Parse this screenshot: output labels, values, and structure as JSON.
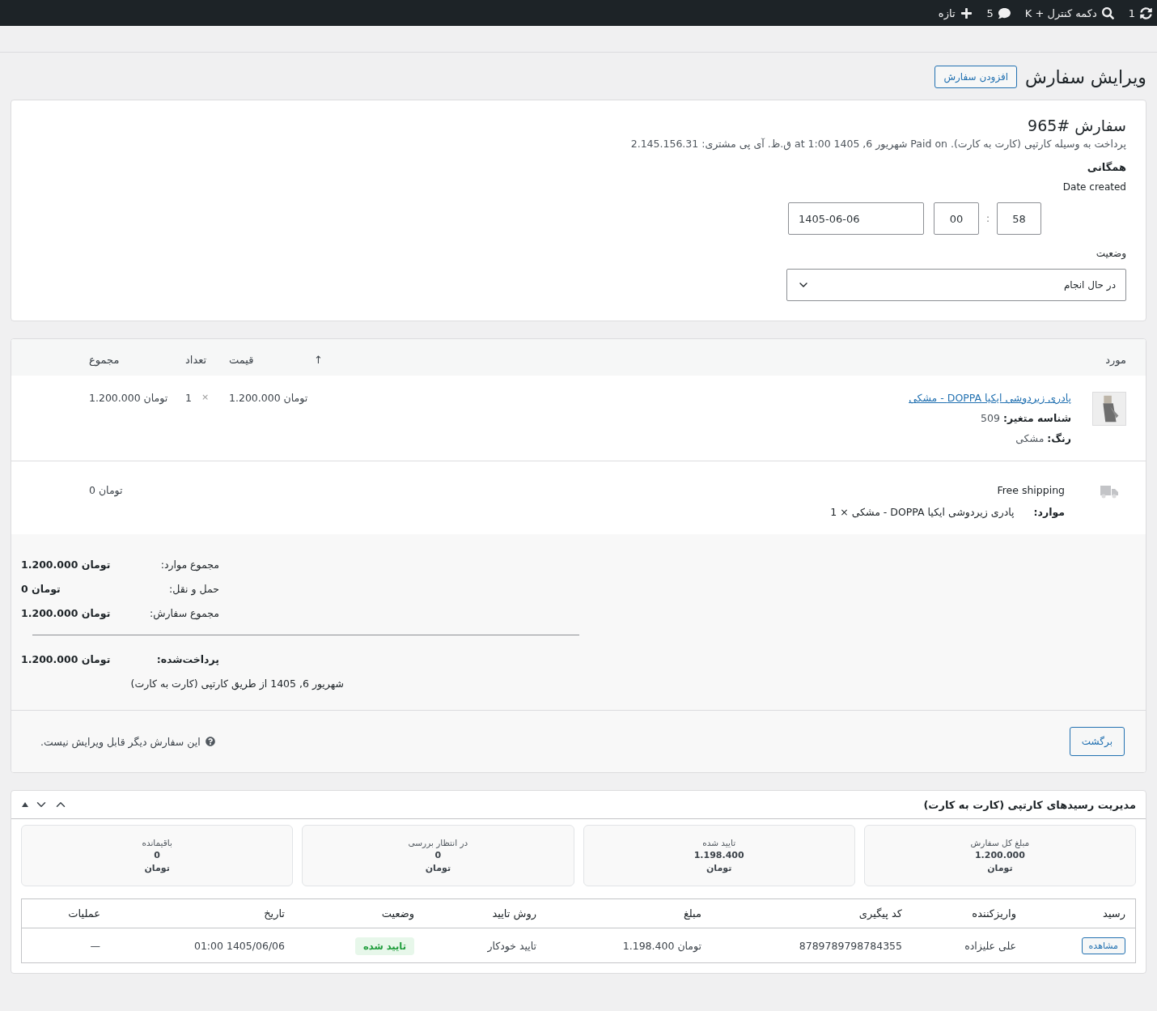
{
  "admin_bar": {
    "items": [
      {
        "kind": "updates",
        "label": "1"
      },
      {
        "kind": "search",
        "label": "دکمه کنترل + K"
      },
      {
        "kind": "comments",
        "label": "5"
      },
      {
        "kind": "new",
        "label": "تازه"
      }
    ]
  },
  "page": {
    "title": "ویرایش سفارش",
    "add_button": "افزودن سفارش"
  },
  "order": {
    "title": "سفارش #965",
    "meta": "پرداخت به وسیله کارتپی (کارت به کارت). Paid on شهریور 6, 1405 at 1:00 ق.ظ. آی پی مشتری: 2.145.156.31",
    "section": "همگانی",
    "date_label": "Date created",
    "date": "1405-06-06",
    "hour": "00",
    "separator": ":",
    "minute": "58",
    "status_label": "وضعیت",
    "status": "در حال انجام"
  },
  "items": {
    "columns": [
      "مورد",
      "↑",
      "قیمت",
      "تعداد",
      "مجموع"
    ],
    "rows": [
      {
        "name": "پادری زیردوشی ایکیا DOPPA - مشکی",
        "meta": [
          "**شناسه متغیر:** 509",
          "**رنگ:** مشکی"
        ],
        "price": "1.200.000 تومان",
        "qty_sign": "×",
        "qty": "1",
        "total": "1.200.000 تومان"
      }
    ],
    "shipping": {
      "method": "Free shipping",
      "items_label": "موارد:",
      "items": "پادری زیردوشی ایکیا DOPPA - مشکی × 1",
      "total": "0 تومان"
    },
    "totals": [
      {
        "label": "مجموع موارد:",
        "value": "1.200.000 تومان"
      },
      {
        "label": "حمل و نقل:",
        "value": "0 تومان"
      },
      {
        "label": "مجموع سفارش:",
        "value": "1.200.000 تومان"
      }
    ],
    "paid": {
      "label": "پرداخت‌شده:",
      "value": "1.200.000 تومان",
      "note": "شهریور 6, 1405 از طریق کارتپی (کارت به کارت)"
    },
    "back_button": "برگشت",
    "notice": "این سفارش دیگر قابل ویرایش نیست."
  },
  "receipts": {
    "title": "مدیریت رسیدهای کارتپی (کارت به کارت)",
    "stats": [
      {
        "label": "مبلغ کل سفارش",
        "value": "1.200.000",
        "unit": "تومان"
      },
      {
        "label": "تایید شده",
        "value": "1.198.400",
        "unit": "تومان"
      },
      {
        "label": "در انتظار بررسی",
        "value": "0",
        "unit": "تومان"
      },
      {
        "label": "باقیمانده",
        "value": "0",
        "unit": "تومان"
      }
    ],
    "columns": [
      "رسید",
      "واریزکننده",
      "کد پیگیری",
      "مبلغ",
      "روش تایید",
      "وضعیت",
      "تاریخ",
      "عملیات"
    ],
    "rows": [
      {
        "action": "مشاهده",
        "payer": "علی علیزاده",
        "tracking": "8789789798784355",
        "amount": "1.198.400 تومان",
        "method": "تایید خودکار",
        "status": "تایید شده",
        "date": "1405/06/06 01:00",
        "operations": "—"
      }
    ]
  }
}
